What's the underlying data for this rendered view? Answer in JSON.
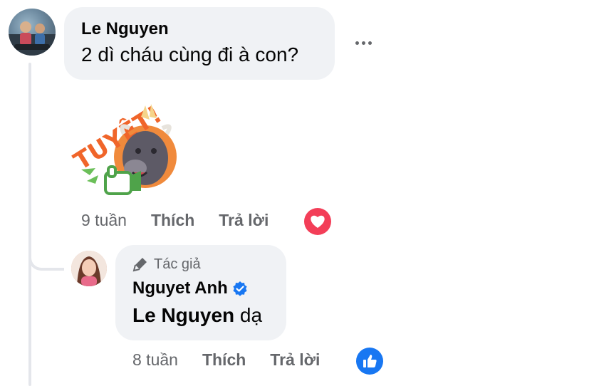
{
  "comment": {
    "author": "Le Nguyen",
    "text": "2 dì cháu cùng đi à con?",
    "time": "9 tuần",
    "like_label": "Thích",
    "reply_label": "Trả lời",
    "reaction": "heart-icon",
    "more_icon": "more-options-icon",
    "sticker_text": "TUYỆT!"
  },
  "reply": {
    "badge_label": "Tác giả",
    "badge_icon": "microphone-icon",
    "author": "Nguyet Anh",
    "verified_icon": "verified-badge-icon",
    "mention": "Le Nguyen",
    "text": "dạ",
    "time": "8 tuần",
    "like_label": "Thích",
    "reply_label": "Trả lời",
    "reaction": "like-icon"
  },
  "colors": {
    "bubble": "#f0f2f5",
    "meta_text": "#65676b",
    "heart": "#f33e58",
    "like": "#1877f2",
    "verified": "#1877f2"
  }
}
